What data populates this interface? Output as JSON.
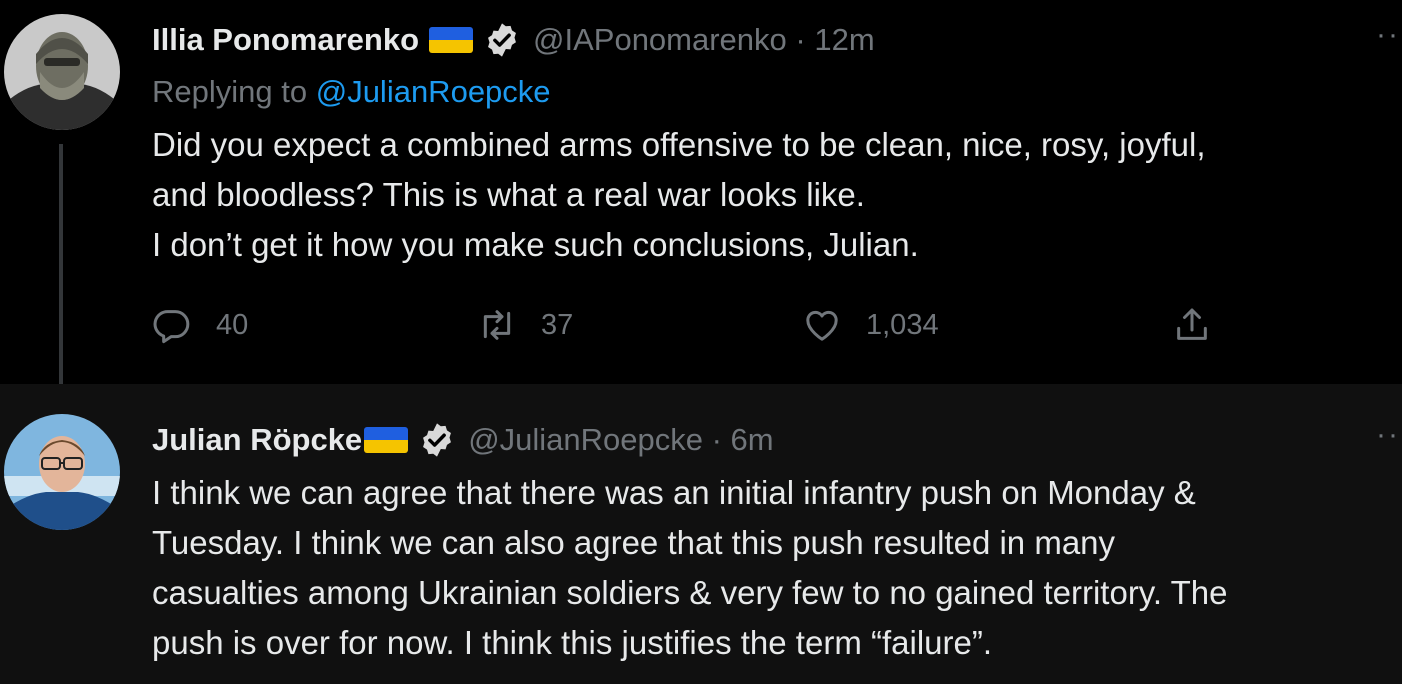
{
  "tweets": [
    {
      "author_name": "Illia Ponomarenko",
      "handle_time": "@IAPonomarenko · 12m",
      "replying_prefix": "Replying to",
      "replying_to": "@JulianRoepcke",
      "text_lines": [
        "Did you expect a combined arms offensive to be clean, nice, rosy, joyful,",
        "and bloodless? This is what a real war looks like.",
        "I don’t get it how you make such conclusions, Julian."
      ],
      "replies": "40",
      "retweets": "37",
      "likes": "1,034",
      "more": "··"
    },
    {
      "author_name": "Julian Röpcke",
      "handle_time": "@JulianRoepcke · 6m",
      "text_lines": [
        "I think we can agree that there was an initial infantry push on Monday &",
        "Tuesday. I think we can also agree that this push resulted in many",
        "casualties among Ukrainian soldiers & very few to no gained territory. The",
        "push is over for now. I think this justifies the term “failure”."
      ],
      "more": "··"
    }
  ],
  "colors": {
    "background": "#000000",
    "secondary_background": "#101010",
    "text": "#e7e9ea",
    "muted": "#71767b",
    "link": "#1d9bf0",
    "flag_blue": "#1f5fe0",
    "flag_yellow": "#f5c400"
  },
  "icons": [
    "reply-icon",
    "retweet-icon",
    "like-icon",
    "share-icon",
    "verified-badge-icon",
    "ukraine-flag-icon"
  ]
}
